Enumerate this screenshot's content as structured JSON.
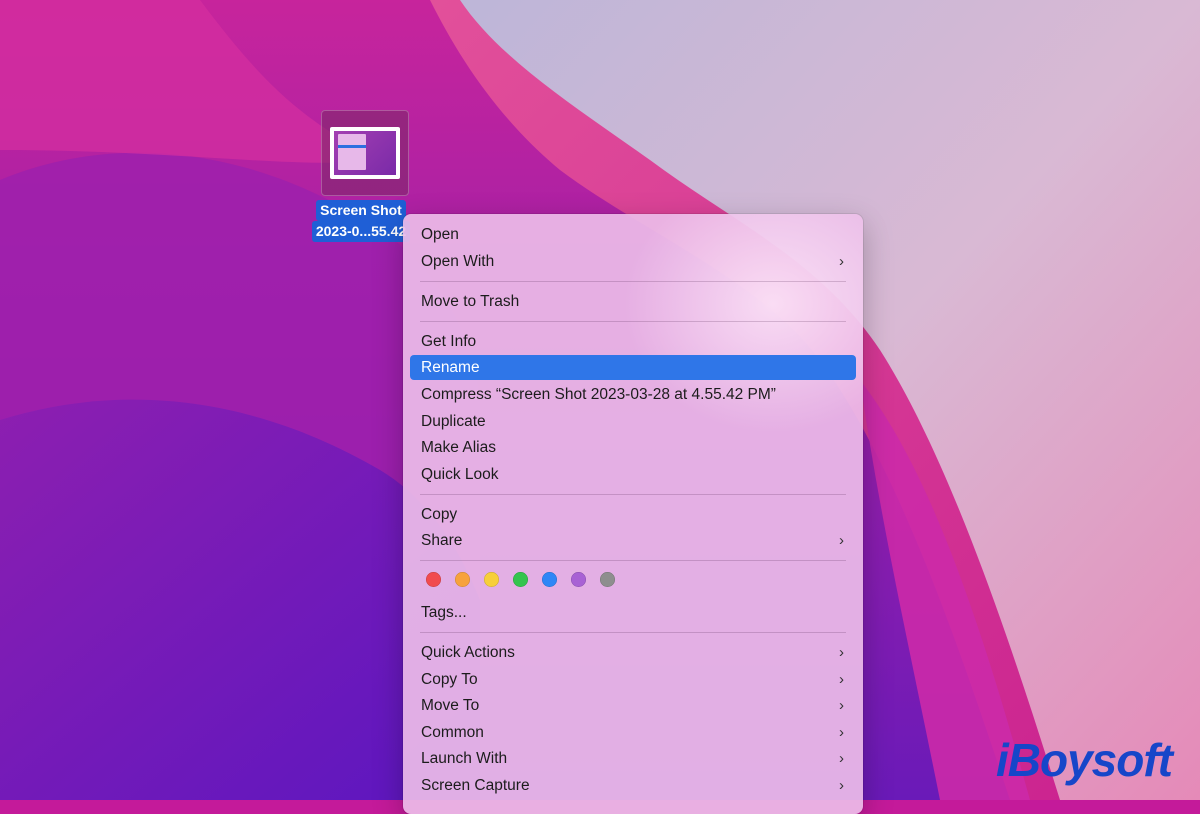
{
  "desktop_file": {
    "label_line1": "Screen Shot",
    "label_line2": "2023-0...55.42"
  },
  "context_menu": {
    "items": [
      {
        "label": "Open"
      },
      {
        "label": "Open With",
        "submenu": true
      },
      {
        "label": "Move to Trash"
      },
      {
        "label": "Get Info"
      },
      {
        "label": "Rename",
        "highlighted": true
      },
      {
        "label": "Compress “Screen Shot 2023-03-28 at 4.55.42 PM”"
      },
      {
        "label": "Duplicate"
      },
      {
        "label": "Make Alias"
      },
      {
        "label": "Quick Look"
      },
      {
        "label": "Copy"
      },
      {
        "label": "Share",
        "submenu": true
      },
      {
        "label": "Tags..."
      },
      {
        "label": "Quick Actions",
        "submenu": true
      },
      {
        "label": "Copy To",
        "submenu": true
      },
      {
        "label": "Move To",
        "submenu": true
      },
      {
        "label": "Common",
        "submenu": true
      },
      {
        "label": "Launch With",
        "submenu": true
      },
      {
        "label": "Screen Capture",
        "submenu": true
      }
    ],
    "submenu_glyph": "›",
    "tag_colors": [
      {
        "name": "red",
        "hex": "#f14b4e"
      },
      {
        "name": "orange",
        "hex": "#f7a23c"
      },
      {
        "name": "yellow",
        "hex": "#f7cf3a"
      },
      {
        "name": "green",
        "hex": "#34c44d"
      },
      {
        "name": "blue",
        "hex": "#2f86f6"
      },
      {
        "name": "purple",
        "hex": "#a862d4"
      },
      {
        "name": "gray",
        "hex": "#8e8e8e"
      }
    ]
  },
  "watermark": {
    "text": "iBoysoft"
  },
  "colors": {
    "highlight": "#2f76e8",
    "selection_label": "#1f5fd6"
  }
}
